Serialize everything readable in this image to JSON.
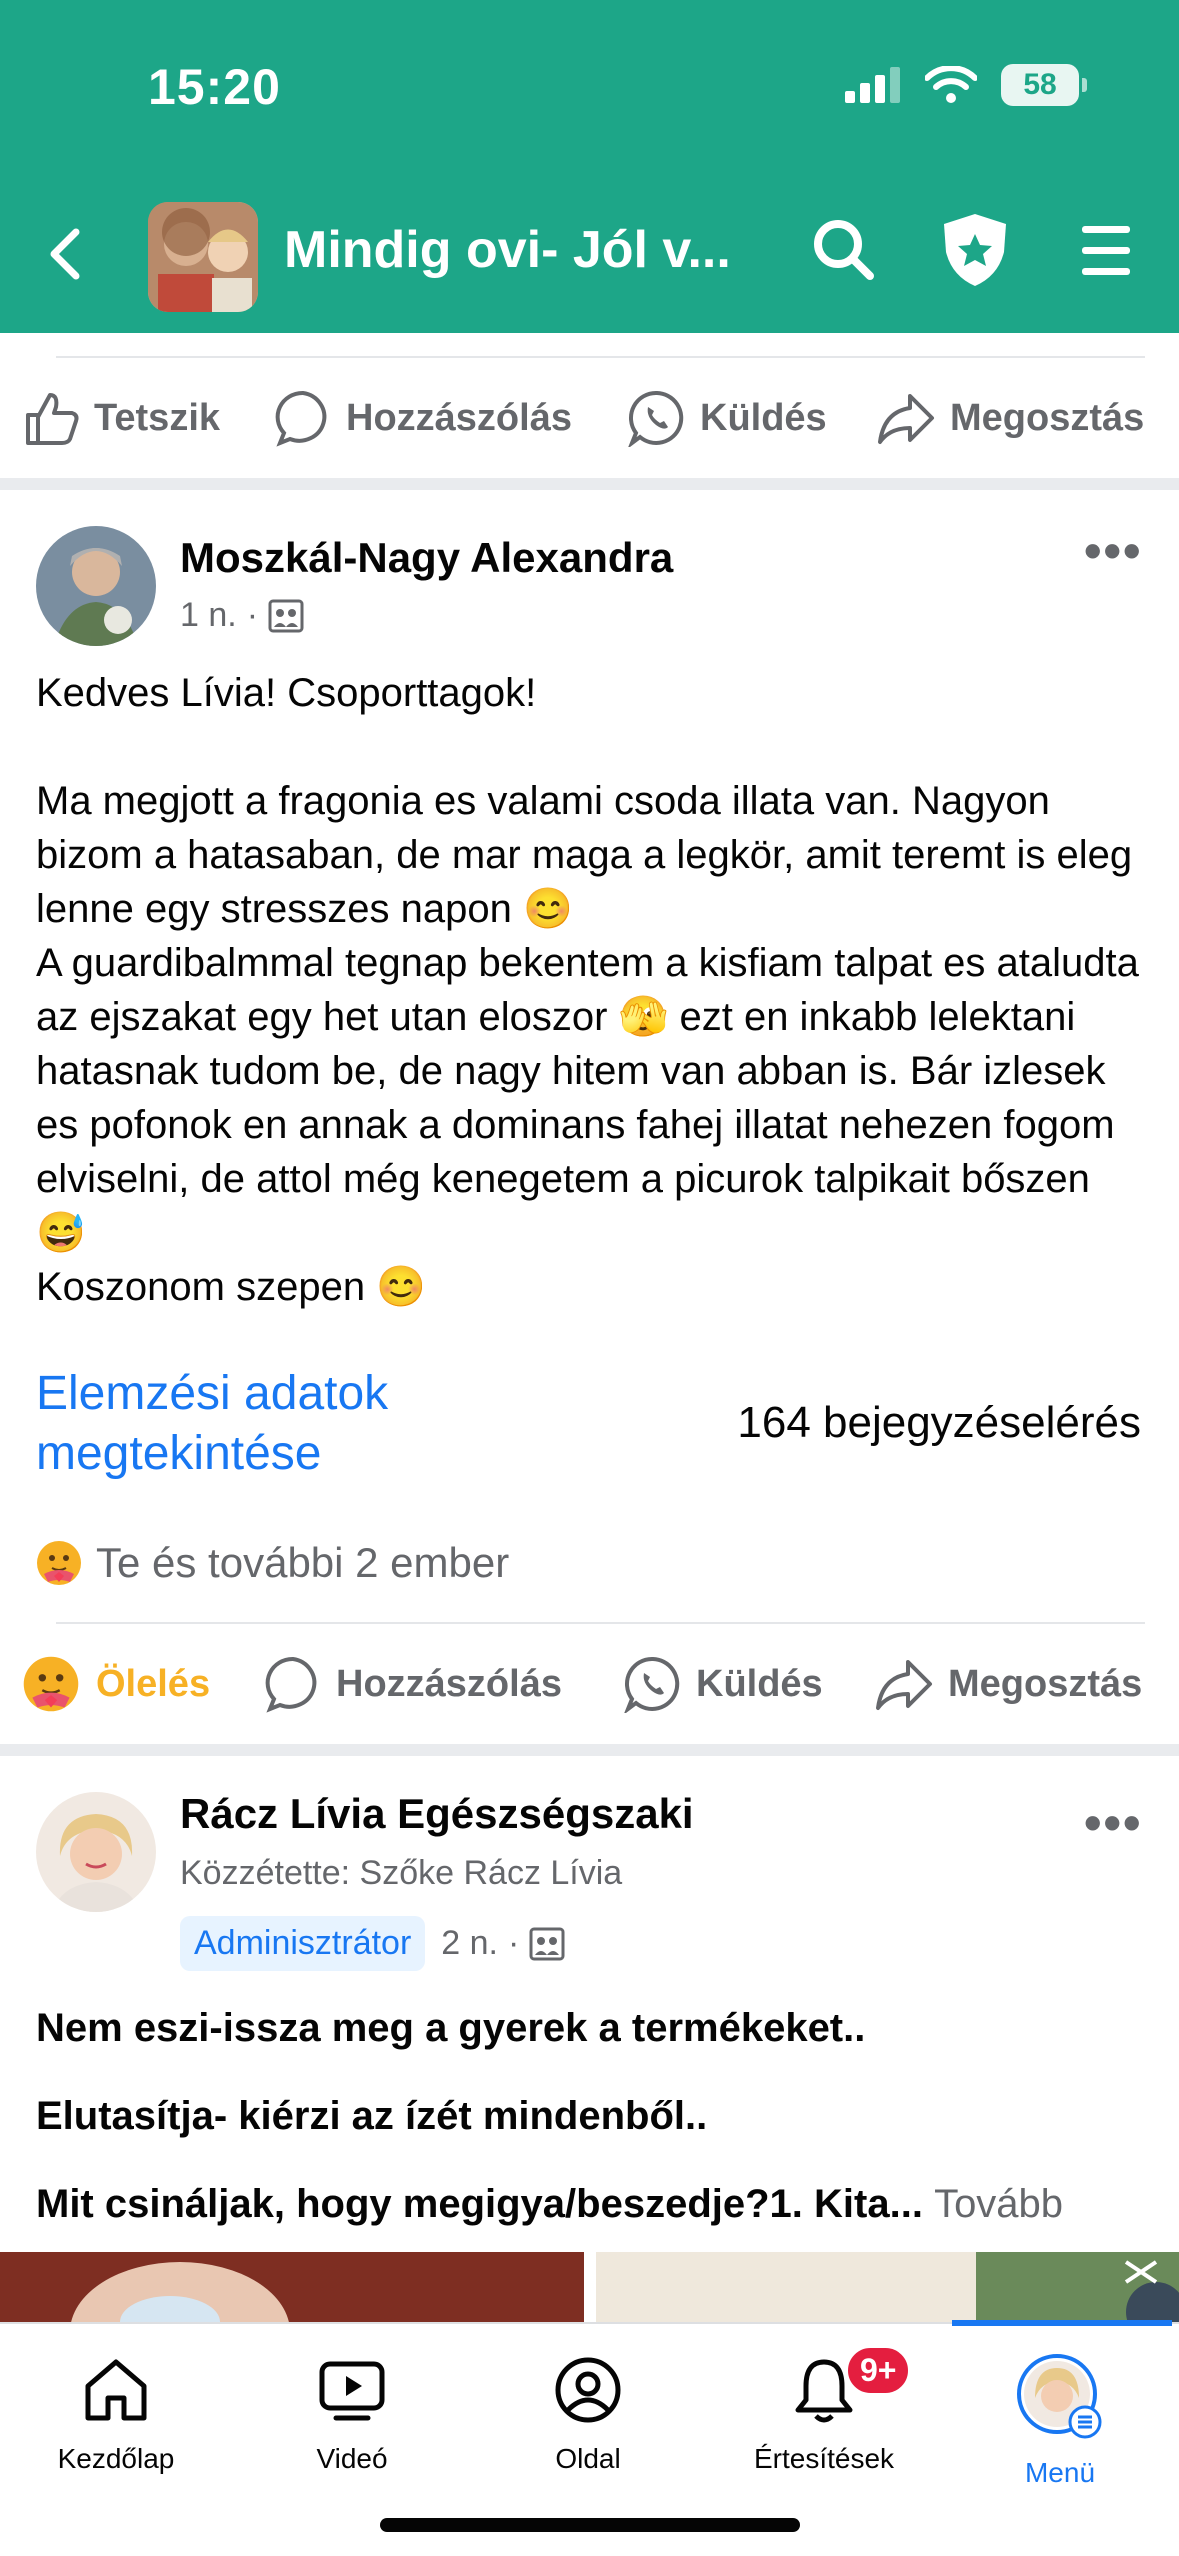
{
  "status_bar": {
    "time": "15:20",
    "battery": "58"
  },
  "header": {
    "group_title": "Mindig ovi- Jól v..."
  },
  "top_actions": {
    "like": "Tetszik",
    "comment": "Hozzászólás",
    "send": "Küldés",
    "share": "Megosztás"
  },
  "post1": {
    "author": "Moszkál-Nagy Alexandra",
    "time": "1 n.",
    "body": "Kedves Lívia! Csoporttagok!\n\nMa megjott a fragonia es valami csoda illata van. Nagyon bizom a hatasaban, de mar maga a legkör, amit teremt is eleg lenne egy stresszes napon 😊\nA guardibalmmal tegnap bekentem a kisfiam talpat es ataludta az ejszakat egy het utan eloszor 🫣 ezt en inkabb lelektani hatasnak tudom be, de nagy hitem van abban is. Bár izlesek es pofonok en annak a dominans fahej illatat nehezen fogom elviselni, de attol még kenegetem a picurok talpikait bőszen 😅\nKoszonom szepen 😊",
    "insights_link": "Elemzési adatok megtekintése",
    "reach": "164 bejegyzéselérés",
    "reactions_text": "Te és további 2 ember",
    "actions": {
      "react": "Ölelés",
      "comment": "Hozzászólás",
      "send": "Küldés",
      "share": "Megosztás"
    }
  },
  "post2": {
    "author": "Rácz Lívia Egészségszaki",
    "posted_by": "Közzétette: Szőke Rácz Lívia",
    "role_badge": "Adminisztrátor",
    "time": "2 n.",
    "line1": "Nem eszi-issza meg a gyerek a termékeket..",
    "line2": "Elutasítja- kiérzi az ízét mindenből..",
    "line3": "Mit csináljak, hogy megigya/beszedje?1. Kita...",
    "see_more": "Tovább"
  },
  "tabbar": {
    "home": "Kezdőlap",
    "video": "Videó",
    "page": "Oldal",
    "notifications": "Értesítések",
    "notifications_badge": "9+",
    "menu": "Menü"
  },
  "colors": {
    "brand": "#1da688",
    "link": "#1877f2",
    "hug": "#f7b125",
    "badge": "#e41e3f"
  }
}
